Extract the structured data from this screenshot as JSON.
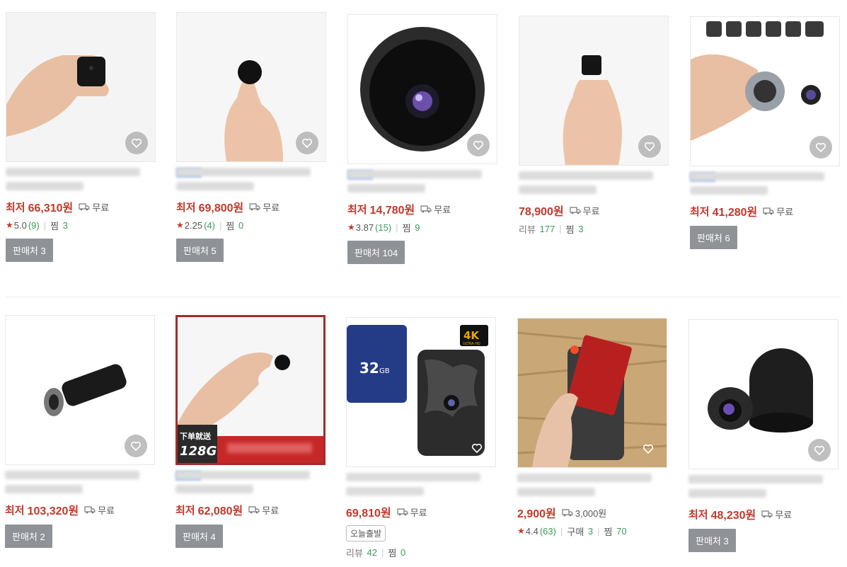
{
  "ui": {
    "heart_icon": "heart-icon",
    "truck_icon": "truck-icon",
    "accent_color": "#c0392b"
  },
  "products": [
    {
      "price_label": "최저",
      "price": "66,310원",
      "shipping": "무료",
      "rating": "5.0",
      "reviews": "(9)",
      "likes_label": "찜",
      "likes": "3",
      "sellers": "판매처 3"
    },
    {
      "price_label": "최저",
      "price": "69,800원",
      "shipping": "무료",
      "rating": "2.25",
      "reviews": "(4)",
      "likes_label": "찜",
      "likes": "0",
      "sellers": "판매처 5"
    },
    {
      "price_label": "최저",
      "price": "14,780원",
      "shipping": "무료",
      "rating": "3.87",
      "reviews": "(15)",
      "likes_label": "찜",
      "likes": "9",
      "sellers": "판매처 104"
    },
    {
      "price": "78,900원",
      "shipping": "무료",
      "review_label": "리뷰",
      "reviews": "177",
      "likes_label": "찜",
      "likes": "3"
    },
    {
      "price_label": "최저",
      "price": "41,280원",
      "shipping": "무료",
      "sellers": "판매처 6"
    },
    {
      "price_label": "최저",
      "price": "103,320원",
      "shipping": "무료",
      "sellers": "판매처 2"
    },
    {
      "price_label": "최저",
      "price": "62,080원",
      "shipping": "무료",
      "sellers": "판매처 4",
      "image_text_1": "下单就送",
      "image_text_2": "128G"
    },
    {
      "price": "69,810원",
      "shipping": "무료",
      "badge": "오늘출발",
      "review_label": "리뷰",
      "reviews": "42",
      "likes_label": "찜",
      "likes": "0",
      "image_text_1": "32",
      "image_text_2": "GB",
      "image_text_3": "4K",
      "image_text_4": "ULTRA HD"
    },
    {
      "price": "2,900원",
      "shipping": "3,000원",
      "rating": "4.4",
      "reviews": "(63)",
      "purchase_label": "구매",
      "purchases": "3",
      "likes_label": "찜",
      "likes": "70"
    },
    {
      "price_label": "최저",
      "price": "48,230원",
      "shipping": "무료",
      "sellers": "판매처 3"
    }
  ]
}
